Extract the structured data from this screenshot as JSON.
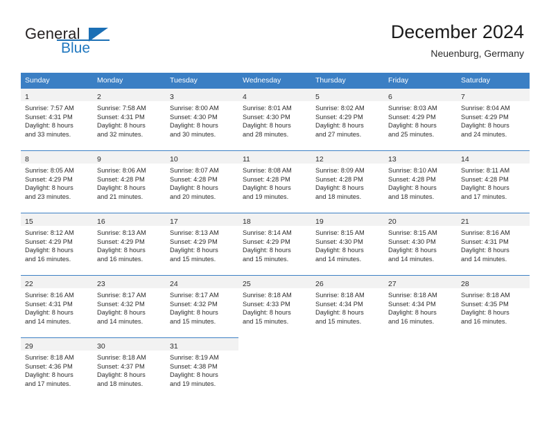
{
  "brand": {
    "name_part1": "General",
    "name_part2": "Blue",
    "accent_color": "#1b6fb5"
  },
  "header": {
    "title": "December 2024",
    "subtitle": "Neuenburg, Germany"
  },
  "theme": {
    "header_row_bg": "#3b7fc4",
    "daynum_band_bg": "#f2f2f2",
    "text_color": "#2b2b2b"
  },
  "weekdays": [
    "Sunday",
    "Monday",
    "Tuesday",
    "Wednesday",
    "Thursday",
    "Friday",
    "Saturday"
  ],
  "labels": {
    "sunrise_prefix": "Sunrise:",
    "sunset_prefix": "Sunset:",
    "daylight_prefix": "Daylight:"
  },
  "weeks": [
    [
      {
        "day": "1",
        "sunrise": "Sunrise: 7:57 AM",
        "sunset": "Sunset: 4:31 PM",
        "daylight1": "Daylight: 8 hours",
        "daylight2": "and 33 minutes."
      },
      {
        "day": "2",
        "sunrise": "Sunrise: 7:58 AM",
        "sunset": "Sunset: 4:31 PM",
        "daylight1": "Daylight: 8 hours",
        "daylight2": "and 32 minutes."
      },
      {
        "day": "3",
        "sunrise": "Sunrise: 8:00 AM",
        "sunset": "Sunset: 4:30 PM",
        "daylight1": "Daylight: 8 hours",
        "daylight2": "and 30 minutes."
      },
      {
        "day": "4",
        "sunrise": "Sunrise: 8:01 AM",
        "sunset": "Sunset: 4:30 PM",
        "daylight1": "Daylight: 8 hours",
        "daylight2": "and 28 minutes."
      },
      {
        "day": "5",
        "sunrise": "Sunrise: 8:02 AM",
        "sunset": "Sunset: 4:29 PM",
        "daylight1": "Daylight: 8 hours",
        "daylight2": "and 27 minutes."
      },
      {
        "day": "6",
        "sunrise": "Sunrise: 8:03 AM",
        "sunset": "Sunset: 4:29 PM",
        "daylight1": "Daylight: 8 hours",
        "daylight2": "and 25 minutes."
      },
      {
        "day": "7",
        "sunrise": "Sunrise: 8:04 AM",
        "sunset": "Sunset: 4:29 PM",
        "daylight1": "Daylight: 8 hours",
        "daylight2": "and 24 minutes."
      }
    ],
    [
      {
        "day": "8",
        "sunrise": "Sunrise: 8:05 AM",
        "sunset": "Sunset: 4:29 PM",
        "daylight1": "Daylight: 8 hours",
        "daylight2": "and 23 minutes."
      },
      {
        "day": "9",
        "sunrise": "Sunrise: 8:06 AM",
        "sunset": "Sunset: 4:28 PM",
        "daylight1": "Daylight: 8 hours",
        "daylight2": "and 21 minutes."
      },
      {
        "day": "10",
        "sunrise": "Sunrise: 8:07 AM",
        "sunset": "Sunset: 4:28 PM",
        "daylight1": "Daylight: 8 hours",
        "daylight2": "and 20 minutes."
      },
      {
        "day": "11",
        "sunrise": "Sunrise: 8:08 AM",
        "sunset": "Sunset: 4:28 PM",
        "daylight1": "Daylight: 8 hours",
        "daylight2": "and 19 minutes."
      },
      {
        "day": "12",
        "sunrise": "Sunrise: 8:09 AM",
        "sunset": "Sunset: 4:28 PM",
        "daylight1": "Daylight: 8 hours",
        "daylight2": "and 18 minutes."
      },
      {
        "day": "13",
        "sunrise": "Sunrise: 8:10 AM",
        "sunset": "Sunset: 4:28 PM",
        "daylight1": "Daylight: 8 hours",
        "daylight2": "and 18 minutes."
      },
      {
        "day": "14",
        "sunrise": "Sunrise: 8:11 AM",
        "sunset": "Sunset: 4:28 PM",
        "daylight1": "Daylight: 8 hours",
        "daylight2": "and 17 minutes."
      }
    ],
    [
      {
        "day": "15",
        "sunrise": "Sunrise: 8:12 AM",
        "sunset": "Sunset: 4:29 PM",
        "daylight1": "Daylight: 8 hours",
        "daylight2": "and 16 minutes."
      },
      {
        "day": "16",
        "sunrise": "Sunrise: 8:13 AM",
        "sunset": "Sunset: 4:29 PM",
        "daylight1": "Daylight: 8 hours",
        "daylight2": "and 16 minutes."
      },
      {
        "day": "17",
        "sunrise": "Sunrise: 8:13 AM",
        "sunset": "Sunset: 4:29 PM",
        "daylight1": "Daylight: 8 hours",
        "daylight2": "and 15 minutes."
      },
      {
        "day": "18",
        "sunrise": "Sunrise: 8:14 AM",
        "sunset": "Sunset: 4:29 PM",
        "daylight1": "Daylight: 8 hours",
        "daylight2": "and 15 minutes."
      },
      {
        "day": "19",
        "sunrise": "Sunrise: 8:15 AM",
        "sunset": "Sunset: 4:30 PM",
        "daylight1": "Daylight: 8 hours",
        "daylight2": "and 14 minutes."
      },
      {
        "day": "20",
        "sunrise": "Sunrise: 8:15 AM",
        "sunset": "Sunset: 4:30 PM",
        "daylight1": "Daylight: 8 hours",
        "daylight2": "and 14 minutes."
      },
      {
        "day": "21",
        "sunrise": "Sunrise: 8:16 AM",
        "sunset": "Sunset: 4:31 PM",
        "daylight1": "Daylight: 8 hours",
        "daylight2": "and 14 minutes."
      }
    ],
    [
      {
        "day": "22",
        "sunrise": "Sunrise: 8:16 AM",
        "sunset": "Sunset: 4:31 PM",
        "daylight1": "Daylight: 8 hours",
        "daylight2": "and 14 minutes."
      },
      {
        "day": "23",
        "sunrise": "Sunrise: 8:17 AM",
        "sunset": "Sunset: 4:32 PM",
        "daylight1": "Daylight: 8 hours",
        "daylight2": "and 14 minutes."
      },
      {
        "day": "24",
        "sunrise": "Sunrise: 8:17 AM",
        "sunset": "Sunset: 4:32 PM",
        "daylight1": "Daylight: 8 hours",
        "daylight2": "and 15 minutes."
      },
      {
        "day": "25",
        "sunrise": "Sunrise: 8:18 AM",
        "sunset": "Sunset: 4:33 PM",
        "daylight1": "Daylight: 8 hours",
        "daylight2": "and 15 minutes."
      },
      {
        "day": "26",
        "sunrise": "Sunrise: 8:18 AM",
        "sunset": "Sunset: 4:34 PM",
        "daylight1": "Daylight: 8 hours",
        "daylight2": "and 15 minutes."
      },
      {
        "day": "27",
        "sunrise": "Sunrise: 8:18 AM",
        "sunset": "Sunset: 4:34 PM",
        "daylight1": "Daylight: 8 hours",
        "daylight2": "and 16 minutes."
      },
      {
        "day": "28",
        "sunrise": "Sunrise: 8:18 AM",
        "sunset": "Sunset: 4:35 PM",
        "daylight1": "Daylight: 8 hours",
        "daylight2": "and 16 minutes."
      }
    ],
    [
      {
        "day": "29",
        "sunrise": "Sunrise: 8:18 AM",
        "sunset": "Sunset: 4:36 PM",
        "daylight1": "Daylight: 8 hours",
        "daylight2": "and 17 minutes."
      },
      {
        "day": "30",
        "sunrise": "Sunrise: 8:18 AM",
        "sunset": "Sunset: 4:37 PM",
        "daylight1": "Daylight: 8 hours",
        "daylight2": "and 18 minutes."
      },
      {
        "day": "31",
        "sunrise": "Sunrise: 8:19 AM",
        "sunset": "Sunset: 4:38 PM",
        "daylight1": "Daylight: 8 hours",
        "daylight2": "and 19 minutes."
      },
      null,
      null,
      null,
      null
    ]
  ]
}
